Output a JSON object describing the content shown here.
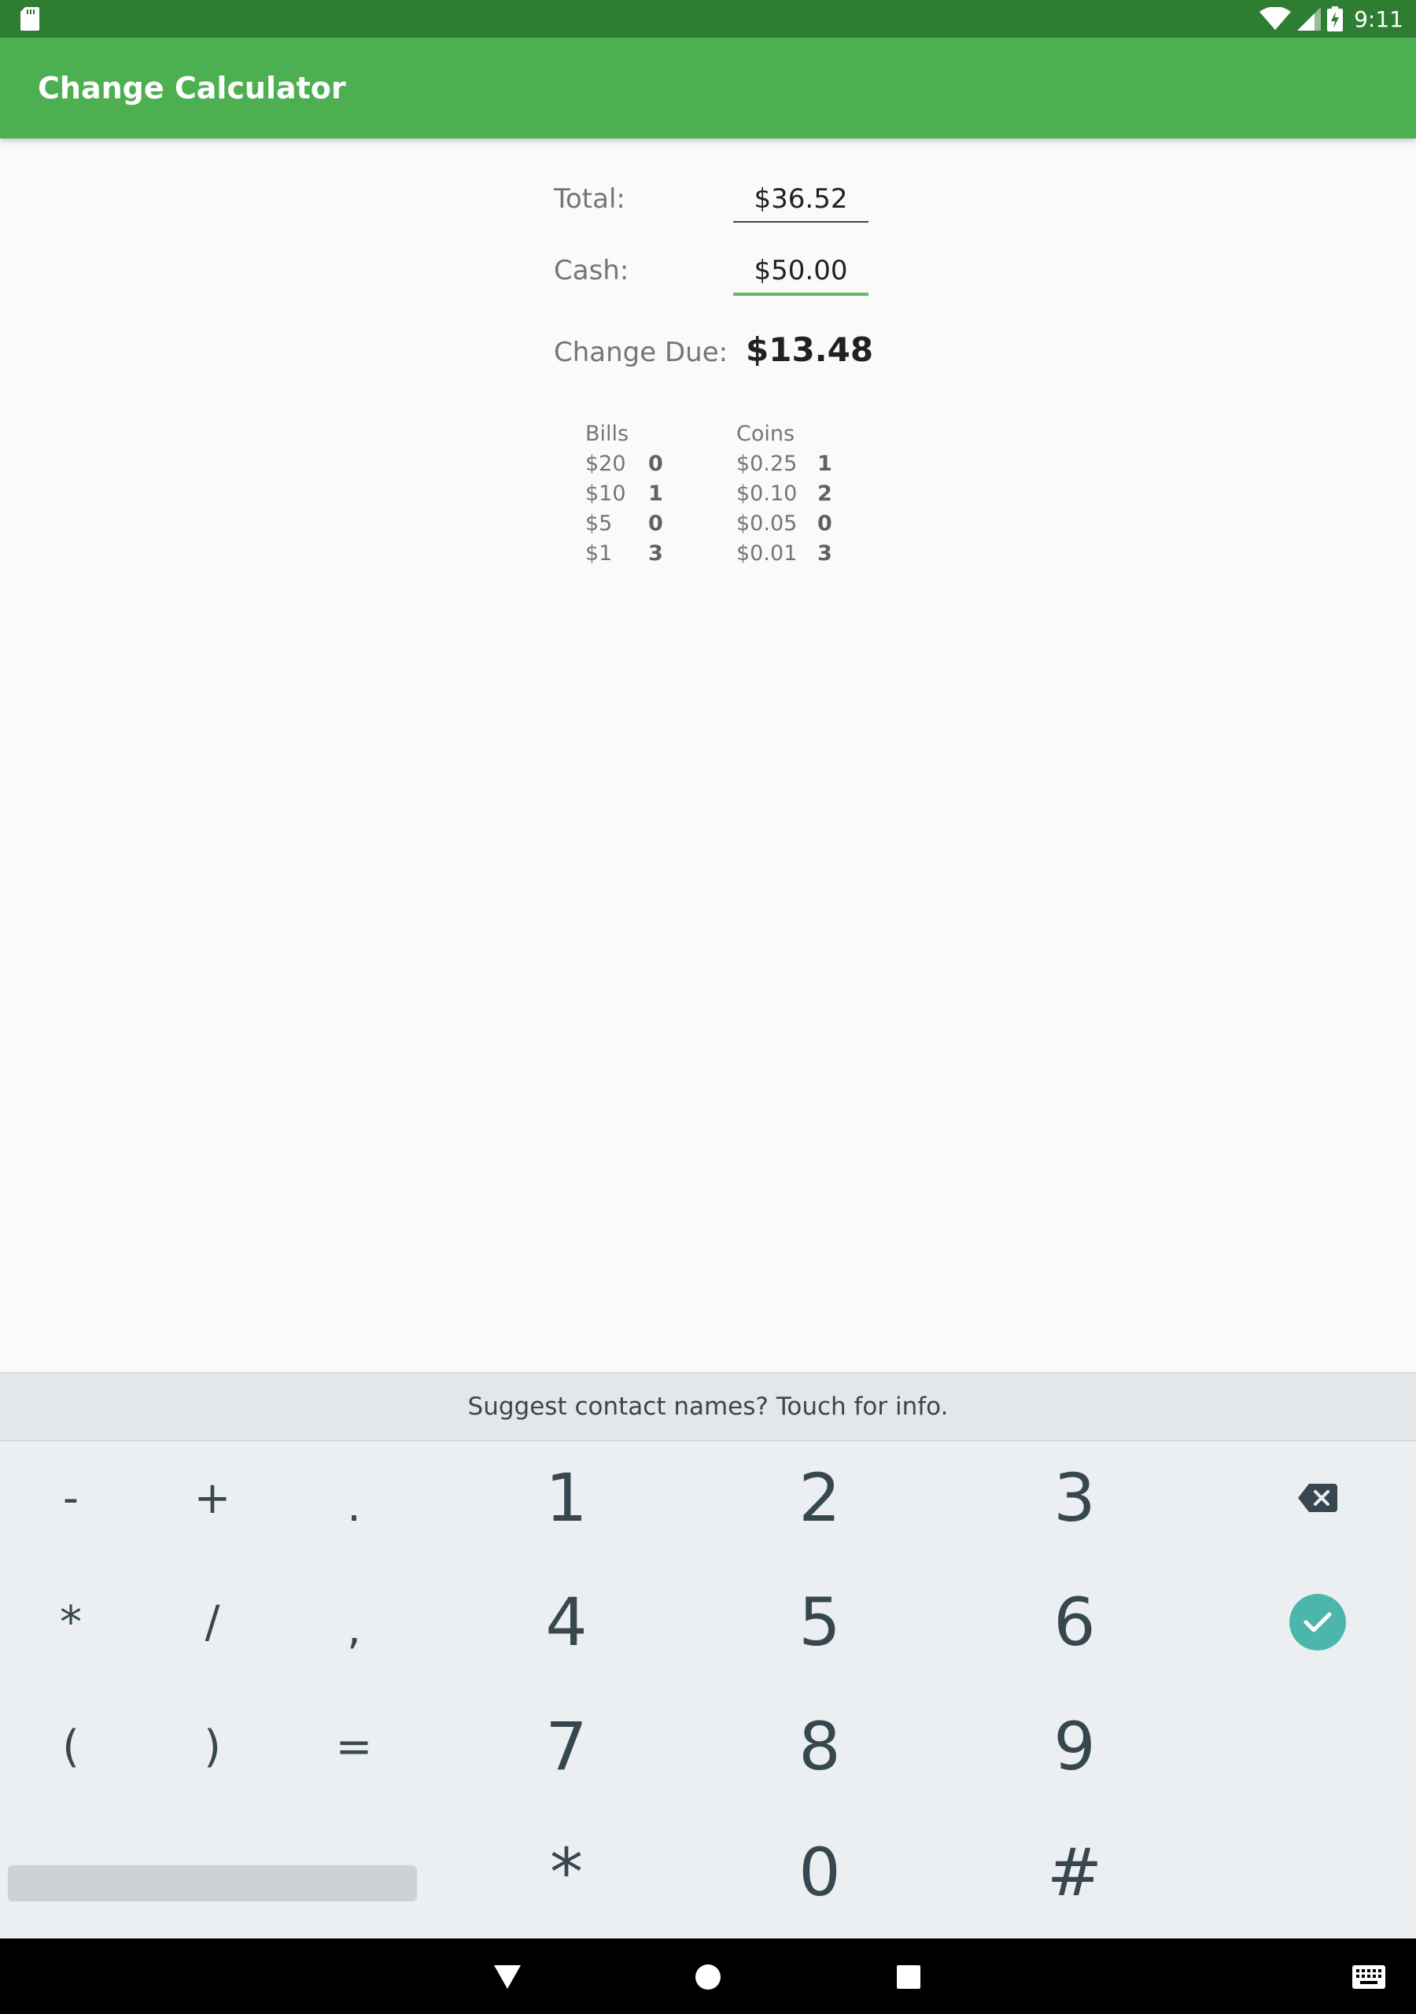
{
  "status_bar": {
    "time": "9:11"
  },
  "app": {
    "title": "Change Calculator"
  },
  "form": {
    "total_label": "Total:",
    "total_value": "$36.52",
    "cash_label": "Cash:",
    "cash_value": "$50.00",
    "change_label": "Change Due:",
    "change_value": "$13.48"
  },
  "breakdown": {
    "bills_header": "Bills",
    "coins_header": "Coins",
    "bills": [
      {
        "denomination": "$20",
        "count": "0"
      },
      {
        "denomination": "$10",
        "count": "1"
      },
      {
        "denomination": "$5",
        "count": "0"
      },
      {
        "denomination": "$1",
        "count": "3"
      }
    ],
    "coins": [
      {
        "denomination": "$0.25",
        "count": "1"
      },
      {
        "denomination": "$0.10",
        "count": "2"
      },
      {
        "denomination": "$0.05",
        "count": "0"
      },
      {
        "denomination": "$0.01",
        "count": "3"
      }
    ]
  },
  "keyboard": {
    "suggestion": "Suggest contact names? Touch for info.",
    "symbols": [
      "-",
      "+",
      ".",
      "*",
      "/",
      ",",
      "(",
      ")",
      "="
    ],
    "digits": [
      "1",
      "2",
      "3",
      "4",
      "5",
      "6",
      "7",
      "8",
      "9",
      "*",
      "0",
      "#"
    ],
    "accent_color": "#4DB6AC"
  },
  "theme": {
    "primary": "#4CAF50",
    "primary_dark": "#2E7D32"
  }
}
